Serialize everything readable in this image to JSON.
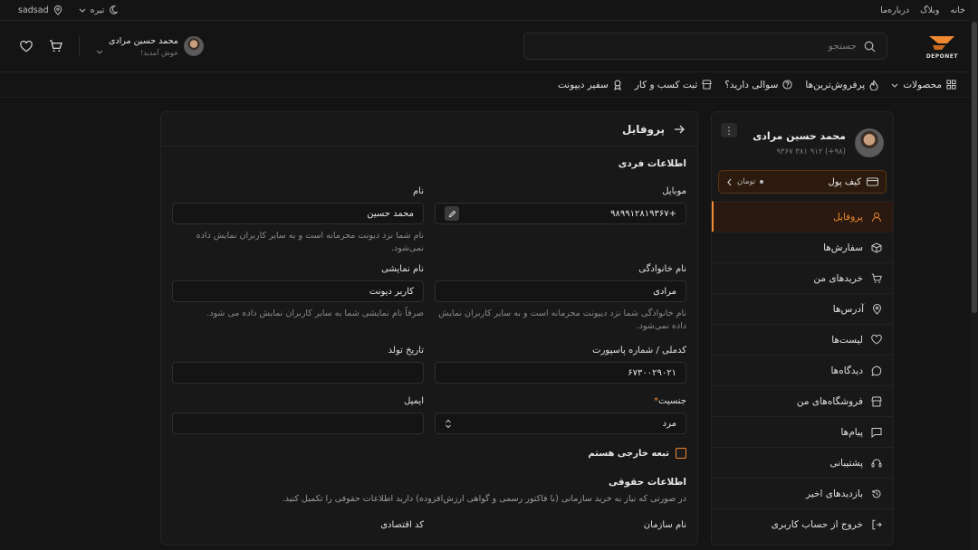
{
  "topbar": {
    "links": [
      "خانه",
      "وبلاگ",
      "درباره‌ما"
    ],
    "theme": "تیره",
    "location": "sadsad"
  },
  "header": {
    "logo_text": "DEPONET",
    "search_placeholder": "جستجو",
    "user_name": "محمد حسین مرادی",
    "user_greeting": "خوش آمدید!"
  },
  "nav": [
    "محصولات",
    "پرفروش‌ترین‌ها",
    "سوالی دارید؟",
    "ثبت کسب و کار",
    "سفیر دیپونت"
  ],
  "sidebar": {
    "name": "محمد حسین مرادی",
    "phone": "(۹۸+) ۹۱۲ ۳۸۱ ۹۳۶۷",
    "wallet_label": "کیف پول",
    "wallet_currency": "تومان",
    "menu": [
      "پروفایل",
      "سفارش‌ها",
      "خریدهای من",
      "آدرس‌ها",
      "لیست‌ها",
      "دیدگاه‌ها",
      "فروشگاه‌های من",
      "پیام‌ها",
      "پشتیبانی",
      "بازدیدهای اخیر",
      "خروج از حساب کاربری"
    ]
  },
  "profile": {
    "title": "پروفایل",
    "section_personal": "اطلاعات فردی",
    "mobile_label": "موبایل",
    "mobile_value": "+۹۸۹۹۱۲۸۱۹۳۶۷",
    "name_label": "نام",
    "name_value": "محمد حسین",
    "name_hint": "نام شما نزد دیونت محرمانه است و به سایر کاربران نمایش داده نمی‌شود.",
    "family_label": "نام خانوادگی",
    "family_value": "مرادی",
    "family_hint": "نام خانوادگی شما نزد دیپونت محرمانه است و به سایر کاربران نمایش داده نمی‌شود.",
    "display_label": "نام نمایشی",
    "display_value": "کاربر دیونت",
    "display_hint": "صرفاً نام نمایشی شما به سایر کاربران نمایش داده می شود.",
    "nid_label": "کدملی / شماره پاسپورت",
    "nid_value": "۶۷۳۰۰۲۹۰۲۱",
    "birth_label": "تاریخ تولد",
    "birth_value": "",
    "gender_label": "جنسیت",
    "gender_value": "مرد",
    "email_label": "ایمیل",
    "email_value": "",
    "foreign_label": "تبعه خارجی هستم",
    "section_legal": "اطلاعات حقوقی",
    "legal_hint": "در صورتی که نیاز به خرید سازمانی (با فاکتور رسمی و گواهی ارزش‌افزوده) دارید اطلاعات حقوقی را تکمیل کنید.",
    "org_label": "نام سازمان",
    "econ_label": "کد اقتصادی"
  },
  "colors": {
    "accent": "#f08a32",
    "bg": "#141414",
    "panel": "#181818"
  }
}
